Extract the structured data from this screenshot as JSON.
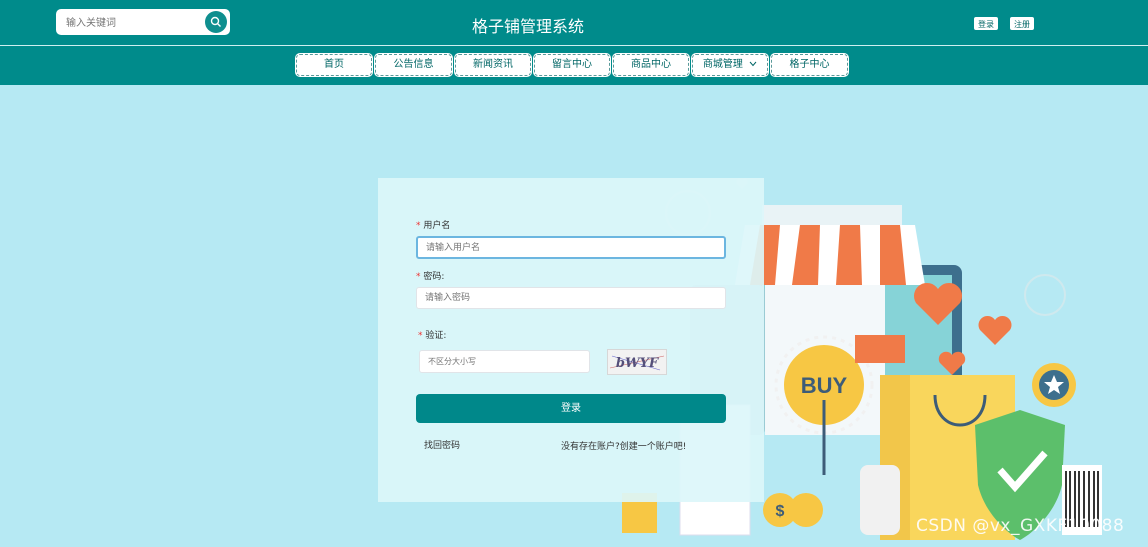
{
  "header": {
    "search_placeholder": "输入关键词",
    "title": "格子铺管理系统",
    "login_label": "登录",
    "register_label": "注册"
  },
  "nav": {
    "items": [
      {
        "label": "首页"
      },
      {
        "label": "公告信息"
      },
      {
        "label": "新闻资讯"
      },
      {
        "label": "留言中心"
      },
      {
        "label": "商品中心"
      },
      {
        "label": "商城管理"
      },
      {
        "label": "格子中心"
      }
    ]
  },
  "login": {
    "username_label": "用户名",
    "username_placeholder": "请输入用户名",
    "password_label": "密码:",
    "password_placeholder": "请输入密码",
    "captcha_label": "验证:",
    "captcha_placeholder": "不区分大小写",
    "captcha_text": "bWYF",
    "submit_label": "登录",
    "forgot_label": "找回密码",
    "register_link": "没有存在账户?创建一个账户吧!"
  },
  "illustration": {
    "buy_text": "BUY",
    "coin_symbol": "$"
  },
  "watermark": "CSDN @vx_GXKF10088",
  "colors": {
    "primary": "#008b8b",
    "background": "#b6e9f3"
  }
}
